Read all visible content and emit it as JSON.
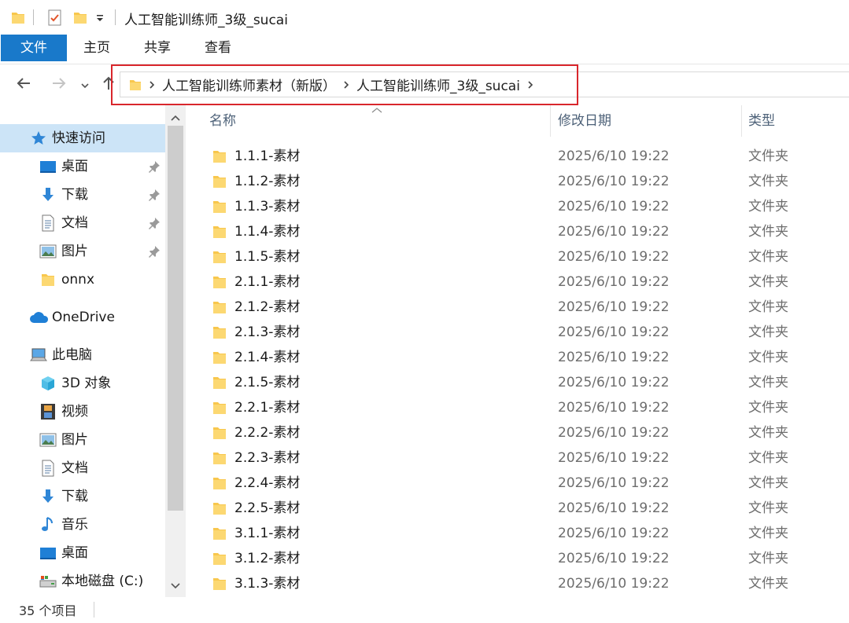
{
  "window": {
    "title": "人工智能训练师_3级_sucai",
    "quick_access_icons": [
      "folder-icon",
      "properties-check-icon",
      "new-folder-icon",
      "customize-dropdown-icon"
    ]
  },
  "ribbon": {
    "tabs": [
      {
        "label": "文件",
        "active": true
      },
      {
        "label": "主页"
      },
      {
        "label": "共享"
      },
      {
        "label": "查看"
      }
    ]
  },
  "navigation": {
    "back_icon": "arrow-left-icon",
    "forward_icon": "arrow-right-icon",
    "recent_icon": "chevron-down-icon",
    "up_icon": "arrow-up-icon"
  },
  "address": {
    "breadcrumbs": [
      "人工智能训练师素材（新版）",
      "人工智能训练师_3级_sucai"
    ],
    "highlight_color": "#d9262c"
  },
  "sidebar": {
    "items": [
      {
        "label": "快速访问",
        "icon": "star-icon",
        "level": 0,
        "selected": true
      },
      {
        "label": "桌面",
        "icon": "desktop-icon",
        "level": 1,
        "pinned": true
      },
      {
        "label": "下载",
        "icon": "download-arrow-icon",
        "level": 1,
        "pinned": true
      },
      {
        "label": "文档",
        "icon": "document-icon",
        "level": 1,
        "pinned": true
      },
      {
        "label": "图片",
        "icon": "pictures-icon",
        "level": 1,
        "pinned": true
      },
      {
        "label": "onnx",
        "icon": "folder-icon",
        "level": 1
      },
      {
        "label": "OneDrive",
        "icon": "cloud-icon",
        "level": 0
      },
      {
        "label": "此电脑",
        "icon": "computer-icon",
        "level": 0
      },
      {
        "label": "3D 对象",
        "icon": "cube-3d-icon",
        "level": 1
      },
      {
        "label": "视频",
        "icon": "video-icon",
        "level": 1
      },
      {
        "label": "图片",
        "icon": "pictures-icon",
        "level": 1
      },
      {
        "label": "文档",
        "icon": "document-icon",
        "level": 1
      },
      {
        "label": "下载",
        "icon": "download-arrow-icon",
        "level": 1
      },
      {
        "label": "音乐",
        "icon": "music-note-icon",
        "level": 1
      },
      {
        "label": "桌面",
        "icon": "desktop-icon",
        "level": 1
      },
      {
        "label": "本地磁盘 (C:)",
        "icon": "disk-drive-icon",
        "level": 1
      }
    ]
  },
  "file_list": {
    "columns": {
      "name": "名称",
      "date": "修改日期",
      "type": "类型"
    },
    "rows": [
      {
        "name": "1.1.1-素材",
        "date": "2025/6/10 19:22",
        "type": "文件夹"
      },
      {
        "name": "1.1.2-素材",
        "date": "2025/6/10 19:22",
        "type": "文件夹"
      },
      {
        "name": "1.1.3-素材",
        "date": "2025/6/10 19:22",
        "type": "文件夹"
      },
      {
        "name": "1.1.4-素材",
        "date": "2025/6/10 19:22",
        "type": "文件夹"
      },
      {
        "name": "1.1.5-素材",
        "date": "2025/6/10 19:22",
        "type": "文件夹"
      },
      {
        "name": "2.1.1-素材",
        "date": "2025/6/10 19:22",
        "type": "文件夹"
      },
      {
        "name": "2.1.2-素材",
        "date": "2025/6/10 19:22",
        "type": "文件夹"
      },
      {
        "name": "2.1.3-素材",
        "date": "2025/6/10 19:22",
        "type": "文件夹"
      },
      {
        "name": "2.1.4-素材",
        "date": "2025/6/10 19:22",
        "type": "文件夹"
      },
      {
        "name": "2.1.5-素材",
        "date": "2025/6/10 19:22",
        "type": "文件夹"
      },
      {
        "name": "2.2.1-素材",
        "date": "2025/6/10 19:22",
        "type": "文件夹"
      },
      {
        "name": "2.2.2-素材",
        "date": "2025/6/10 19:22",
        "type": "文件夹"
      },
      {
        "name": "2.2.3-素材",
        "date": "2025/6/10 19:22",
        "type": "文件夹"
      },
      {
        "name": "2.2.4-素材",
        "date": "2025/6/10 19:22",
        "type": "文件夹"
      },
      {
        "name": "2.2.5-素材",
        "date": "2025/6/10 19:22",
        "type": "文件夹"
      },
      {
        "name": "3.1.1-素材",
        "date": "2025/6/10 19:22",
        "type": "文件夹"
      },
      {
        "name": "3.1.2-素材",
        "date": "2025/6/10 19:22",
        "type": "文件夹"
      },
      {
        "name": "3.1.3-素材",
        "date": "2025/6/10 19:22",
        "type": "文件夹"
      }
    ]
  },
  "status": {
    "item_count": "35 个项目"
  },
  "colors": {
    "accent": "#1979ca",
    "selection": "#cce4f7",
    "folder": "#f8c74d"
  }
}
